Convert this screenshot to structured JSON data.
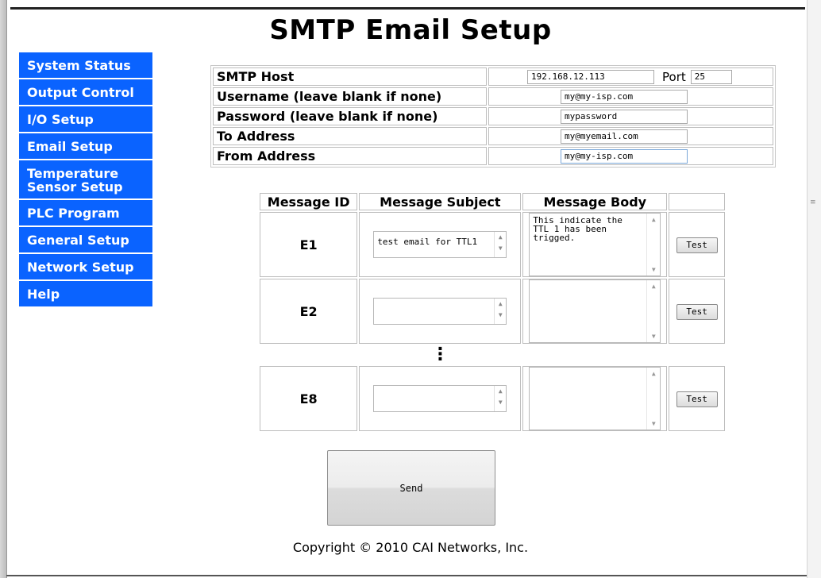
{
  "page": {
    "title": "SMTP Email Setup",
    "copyright": "Copyright © 2010 CAI Networks, Inc."
  },
  "nav": {
    "items": [
      {
        "label": "System Status"
      },
      {
        "label": "Output Control"
      },
      {
        "label": "I/O Setup"
      },
      {
        "label": "Email Setup"
      },
      {
        "label": "Temperature\nSensor Setup"
      },
      {
        "label": "PLC Program"
      },
      {
        "label": "General Setup"
      },
      {
        "label": "Network Setup"
      },
      {
        "label": "Help"
      }
    ],
    "color": "#0a63ff"
  },
  "smtp": {
    "host_label": "SMTP Host",
    "host_value": "192.168.12.113",
    "port_label": "Port",
    "port_value": "25",
    "username_label": "Username (leave blank if none)",
    "username_value": "my@my-isp.com",
    "password_label": "Password (leave blank if none)",
    "password_value": "mypassword",
    "to_label": "To Address",
    "to_value": "my@myemail.com",
    "from_label": "From Address",
    "from_value": "my@my-isp.com"
  },
  "messages": {
    "headers": {
      "id": "Message ID",
      "subject": "Message Subject",
      "body": "Message Body"
    },
    "rows": [
      {
        "id": "E1",
        "subject": "test email for TTL1",
        "body": "This indicate the\nTTL 1 has been\ntrigged.",
        "test_label": "Test"
      },
      {
        "id": "E2",
        "subject": "",
        "body": "",
        "test_label": "Test"
      },
      {
        "id": "E8",
        "subject": "",
        "body": "",
        "test_label": "Test"
      }
    ],
    "ellipsis": "⋮"
  },
  "send_label": "Send"
}
